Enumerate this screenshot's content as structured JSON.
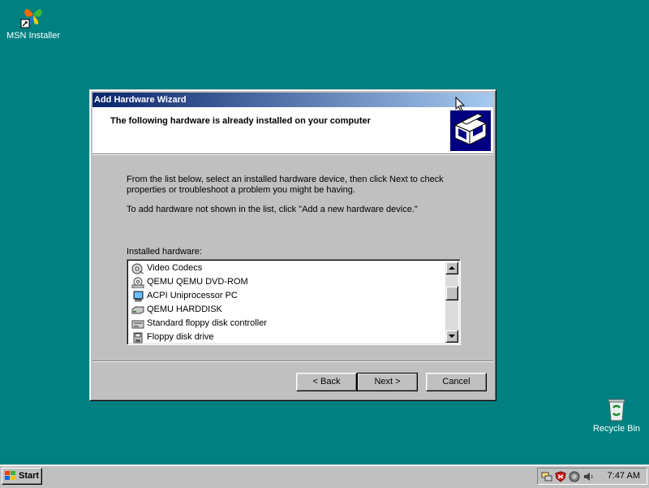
{
  "desktop": {
    "icons": [
      {
        "label": "MSN Installer",
        "icon": "msn-butterfly-icon"
      },
      {
        "label": "Recycle Bin",
        "icon": "recycle-bin-icon"
      }
    ]
  },
  "wizard": {
    "title": "Add Hardware Wizard",
    "header_title": "The following hardware is already installed on your computer",
    "header_icon": "hardware-wizard-icon",
    "description_1": "From the list below, select an installed hardware device, then click Next to check properties or troubleshoot a problem you might be having.",
    "description_2": "To add hardware not shown in the list, click \"Add a new hardware device.\"",
    "list_label": "Installed hardware:",
    "list_items": [
      {
        "label": "Video Codecs",
        "icon": "codec-icon"
      },
      {
        "label": "QEMU QEMU DVD-ROM",
        "icon": "dvd-drive-icon"
      },
      {
        "label": "ACPI Uniprocessor PC",
        "icon": "computer-icon"
      },
      {
        "label": "QEMU HARDDISK",
        "icon": "hard-disk-icon"
      },
      {
        "label": "Standard floppy disk controller",
        "icon": "floppy-controller-icon"
      },
      {
        "label": "Floppy disk drive",
        "icon": "floppy-drive-icon"
      }
    ],
    "buttons": {
      "back": "< Back",
      "next": "Next >",
      "cancel": "Cancel"
    }
  },
  "taskbar": {
    "start_label": "Start",
    "clock": "7:47 AM",
    "tray_icons": [
      "network-icon",
      "security-shield-icon",
      "antivirus-icon",
      "volume-icon"
    ]
  },
  "colors": {
    "desktop": "#008080",
    "title_bar_start": "#0a246a",
    "title_bar_end": "#a6caf0",
    "window_face": "#c0c0c0"
  }
}
